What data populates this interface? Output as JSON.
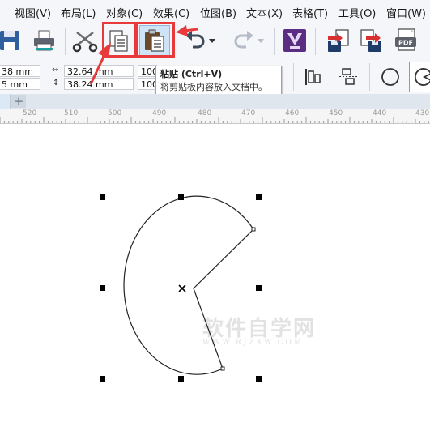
{
  "menu": [
    {
      "label": "视图(V)"
    },
    {
      "label": "布局(L)"
    },
    {
      "label": "对象(C)"
    },
    {
      "label": "效果(C)"
    },
    {
      "label": "位图(B)"
    },
    {
      "label": "文本(X)"
    },
    {
      "label": "表格(T)"
    },
    {
      "label": "工具(O)"
    },
    {
      "label": "窗口(W)"
    }
  ],
  "toolbar": {
    "icons": [
      "save-icon",
      "print-icon",
      "cut-icon",
      "copy-icon",
      "paste-icon",
      "undo-icon",
      "redo-icon",
      "import-icon",
      "export-icon",
      "export-pdf-icon"
    ],
    "pdf_label": "PDF"
  },
  "properties": {
    "x_value": "38 mm",
    "y_value": "5 mm",
    "width_value": "32.64 mm",
    "height_value": "38.24 mm",
    "scale_x": "100",
    "scale_y": "100"
  },
  "tooltip": {
    "title": "粘贴 (Ctrl+V)",
    "description": "将剪贴板内容放入文档中。"
  },
  "ruler": {
    "labels": [
      "520",
      "510",
      "500",
      "490",
      "480",
      "470",
      "460",
      "450",
      "440",
      "430"
    ]
  },
  "watermark": {
    "main": "软件自学网",
    "sub": "WWW.RJZXW.COM"
  },
  "colors": {
    "highlight_red": "#e83a3a",
    "button_hover": "#cfe3f7"
  }
}
